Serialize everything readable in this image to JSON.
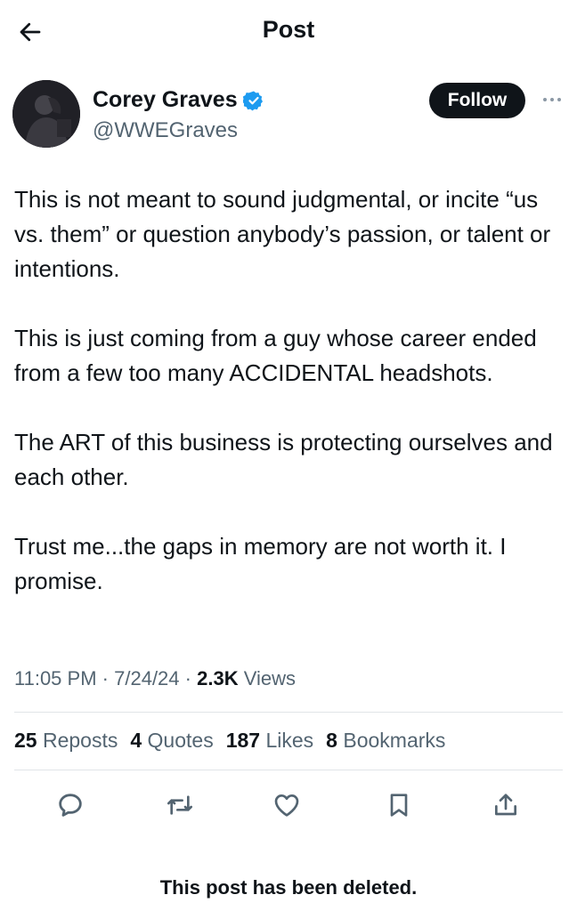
{
  "header": {
    "title": "Post",
    "back_icon": "arrow-left-icon"
  },
  "author": {
    "display_name": "Corey Graves",
    "handle": "@WWEGraves",
    "verified": true,
    "verified_color": "#1d9bf0",
    "follow_label": "Follow"
  },
  "post": {
    "paragraphs": [
      "This is not meant to sound judgmental, or incite “us vs. them” or question anybody’s passion, or talent or intentions.",
      "This is just coming from a guy whose career ended from a few too many ACCIDENTAL headshots.",
      "The ART of this business is protecting ourselves and each other.",
      "Trust me...the gaps in memory are not worth it. I promise."
    ],
    "time": "11:05 PM",
    "separator": "·",
    "date": "7/24/24",
    "views_count": "2.3K",
    "views_label": "Views"
  },
  "stats": {
    "reposts": {
      "count": "25",
      "label": "Reposts"
    },
    "quotes": {
      "count": "4",
      "label": "Quotes"
    },
    "likes": {
      "count": "187",
      "label": "Likes"
    },
    "bookmarks": {
      "count": "8",
      "label": "Bookmarks"
    }
  },
  "actions": [
    "reply-icon",
    "repost-icon",
    "like-icon",
    "bookmark-icon",
    "share-icon"
  ],
  "notice": "This post has been deleted."
}
